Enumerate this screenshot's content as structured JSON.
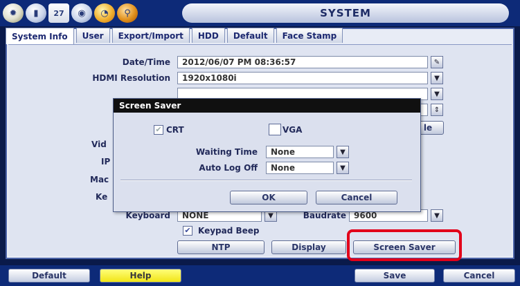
{
  "header": {
    "title": "SYSTEM",
    "calendar_icon_text": "27",
    "icons": [
      "gear-icon",
      "camera-icon",
      "calendar-icon",
      "globe-icon",
      "pie-chart-icon",
      "magnifier-icon"
    ]
  },
  "tabs": [
    "System Info",
    "User",
    "Export/Import",
    "HDD",
    "Default",
    "Face Stamp"
  ],
  "form": {
    "datetime_label": "Date/Time",
    "datetime_value": "2012/06/07 PM 08:36:57",
    "hdmi_label": "HDMI Resolution",
    "hdmi_value": "1920x1080i",
    "row3_value": "",
    "row4_value": "",
    "partial_button": "le",
    "label_vid": "Vid",
    "label_ip": "IP",
    "label_mac": "Mac",
    "label_ke": "Ke",
    "keyboard_label": "Keyboard",
    "keyboard_value": "NONE",
    "baudrate_label": "Baudrate",
    "baudrate_value": "9600",
    "keypad_beep_label": "Keypad Beep"
  },
  "buttons": {
    "ntp": "NTP",
    "display": "Display",
    "screen_saver": "Screen Saver"
  },
  "dialog": {
    "title": "Screen Saver",
    "crt_label": "CRT",
    "vga_label": "VGA",
    "waiting_time_label": "Waiting Time",
    "waiting_time_value": "None",
    "auto_log_off_label": "Auto Log Off",
    "auto_log_off_value": "None",
    "ok": "OK",
    "cancel": "Cancel"
  },
  "bottom": {
    "default": "Default",
    "help": "Help",
    "save": "Save",
    "cancel": "Cancel"
  },
  "colors": {
    "frame_blue": "#0d2a78",
    "highlight_red": "#e2001a",
    "help_yellow": "#f1e516"
  }
}
